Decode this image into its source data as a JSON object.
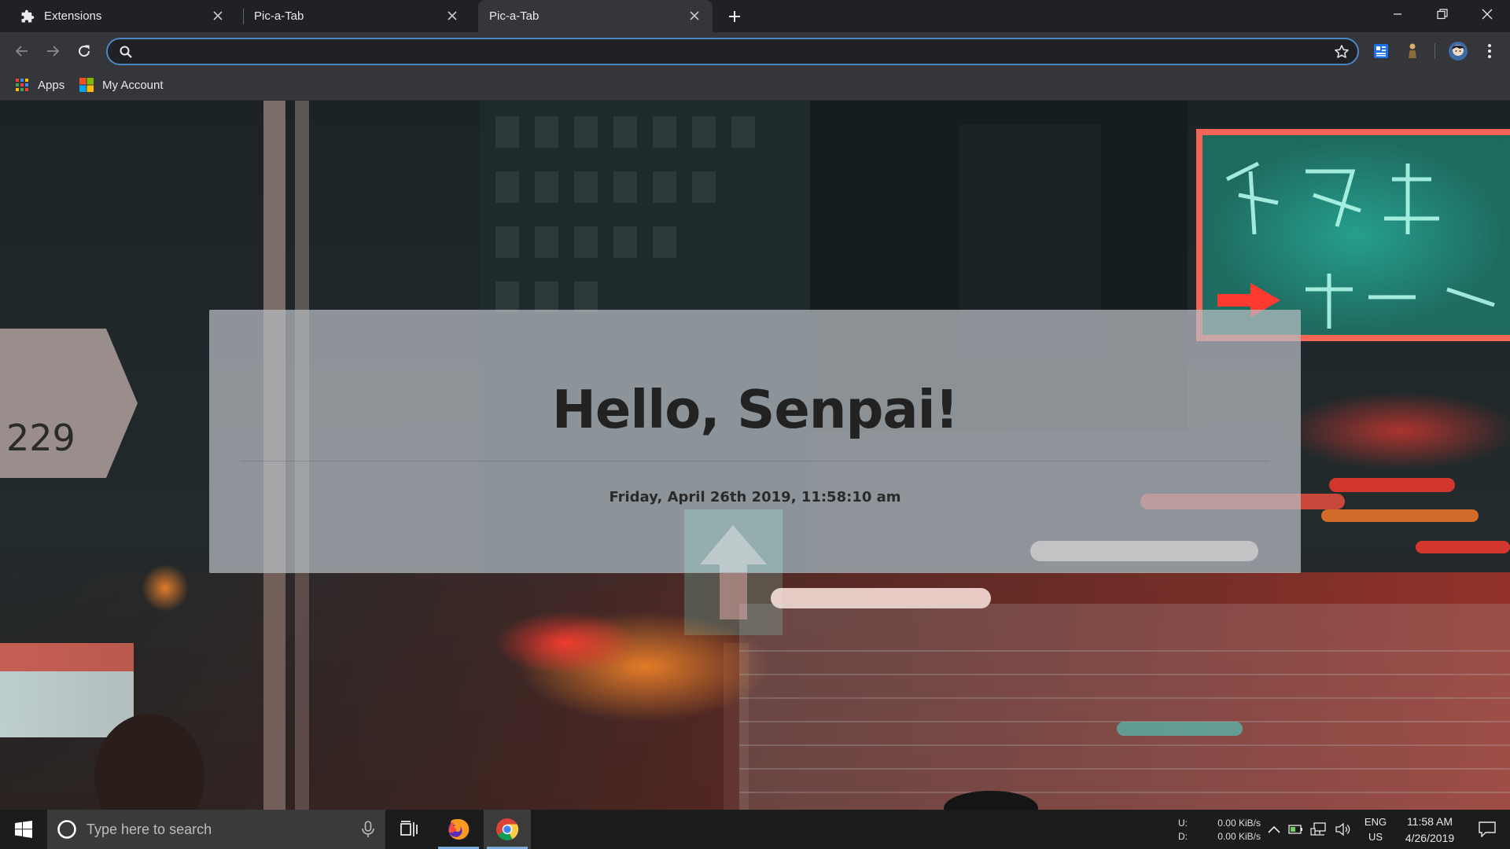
{
  "browser": {
    "tabs": [
      {
        "title": "Extensions",
        "icon": "puzzle-icon",
        "active": false
      },
      {
        "title": "Pic-a-Tab",
        "icon": "none",
        "active": false
      },
      {
        "title": "Pic-a-Tab",
        "icon": "none",
        "active": true
      }
    ],
    "omnibox": {
      "value": "",
      "placeholder": ""
    },
    "bookmarks": [
      {
        "label": "Apps",
        "icon": "apps-grid-icon"
      },
      {
        "label": "My Account",
        "icon": "microsoft-logo-icon"
      }
    ],
    "colors": {
      "accent": "#4b86c6",
      "toolbar": "#35363a",
      "tabstrip": "#202124"
    }
  },
  "page": {
    "greeting": "Hello, Senpai!",
    "datetime": "Friday, April 26th 2019, 11:58:10 am"
  },
  "taskbar": {
    "search_placeholder": "Type here to search",
    "pinned": [
      "task-view-icon",
      "firefox-icon",
      "chrome-icon"
    ],
    "network": {
      "up_label": "U:",
      "down_label": "D:",
      "up_value": "0.00 KiB/s",
      "down_value": "0.00 KiB/s"
    },
    "language": {
      "lang": "ENG",
      "region": "US"
    },
    "clock": {
      "time": "11:58 AM",
      "date": "4/26/2019"
    }
  }
}
